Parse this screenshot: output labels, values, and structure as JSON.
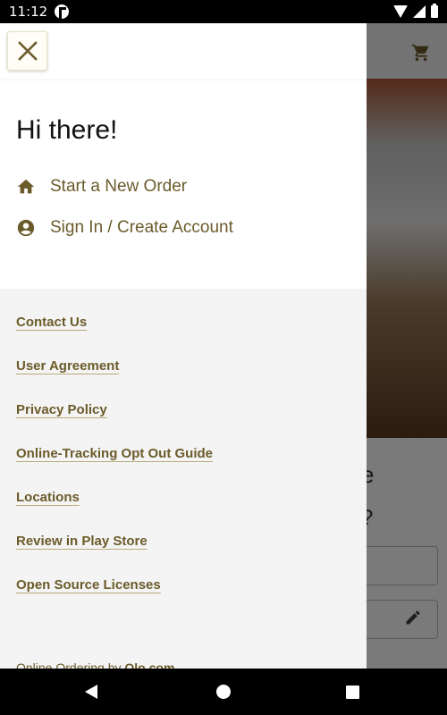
{
  "status_bar": {
    "time": "11:12"
  },
  "background": {
    "partial_text_1": "e",
    "partial_text_2": "?"
  },
  "drawer": {
    "greeting": "Hi there!",
    "primary_items": [
      {
        "label": "Start a New Order",
        "icon": "home-icon"
      },
      {
        "label": "Sign In / Create Account",
        "icon": "account-circle-icon"
      }
    ],
    "links": [
      "Contact Us",
      "User Agreement",
      "Privacy Policy",
      "Online-Tracking Opt Out Guide",
      "Locations",
      "Review in Play Store",
      "Open Source Licenses"
    ],
    "footer_prefix": "Online Ordering by ",
    "footer_brand": "Olo.com"
  },
  "colors": {
    "accent": "#6b5b2a",
    "drawer_bg": "#f4f4f4",
    "scrim": "rgba(0,0,0,0.52)"
  }
}
